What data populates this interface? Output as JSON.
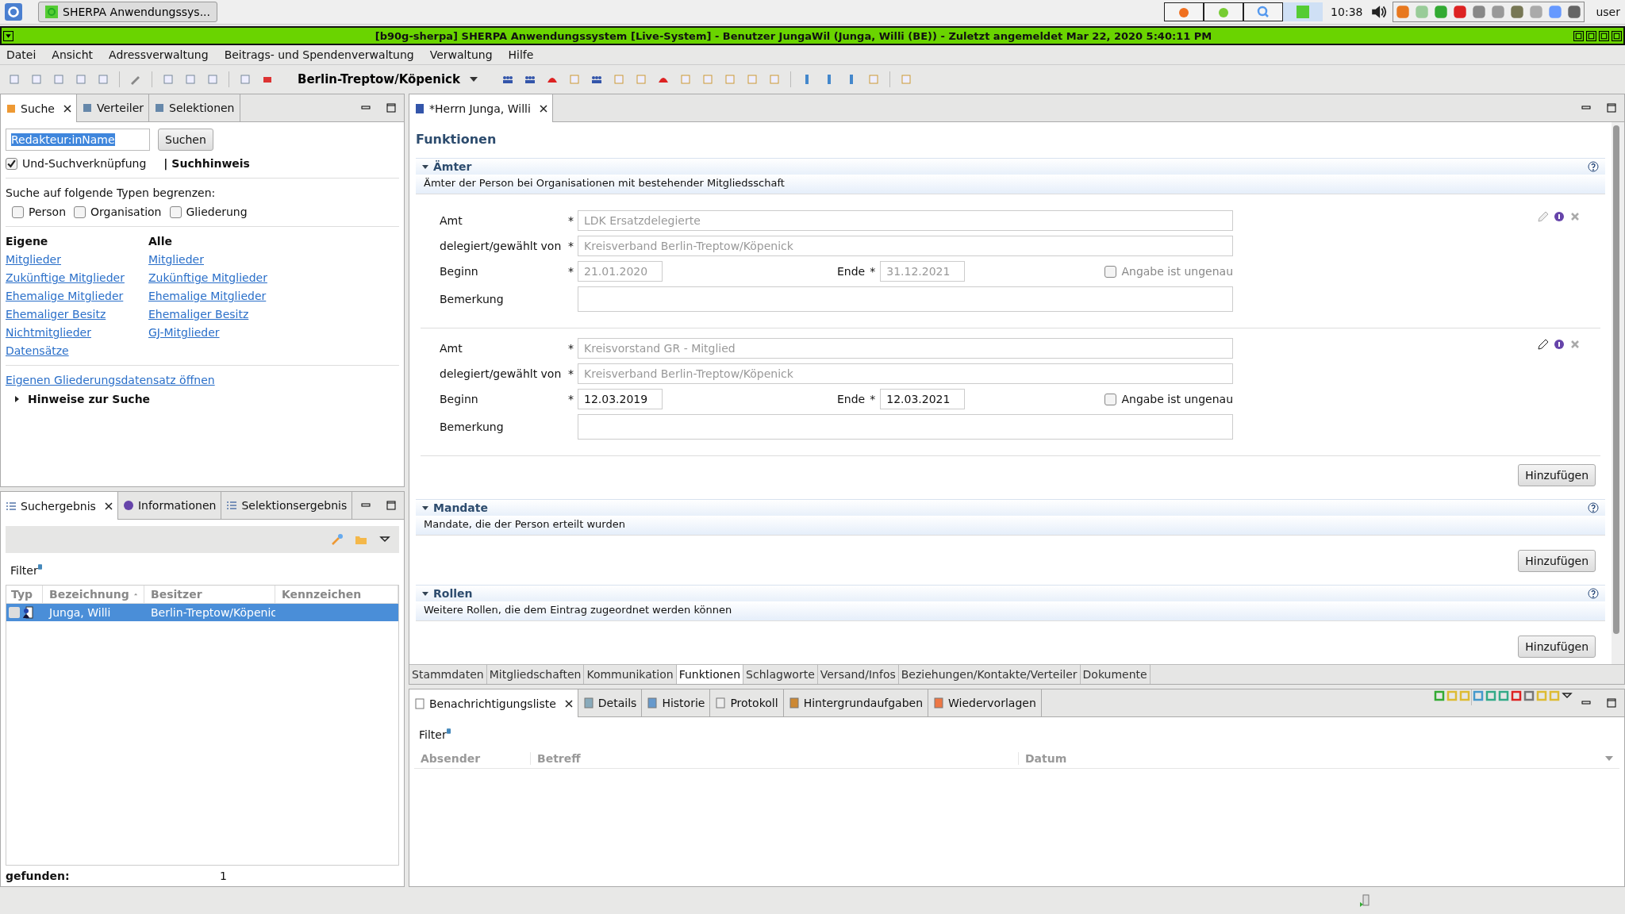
{
  "taskbar": {
    "app_button": "SHERPA Anwendungssys...",
    "clock": "10:38",
    "user": "user"
  },
  "window": {
    "title": "[b90g-sherpa] SHERPA Anwendungssystem [Live-System] - Benutzer JungaWil (Junga, Willi (BE)) - Zuletzt angemeldet Mar 22, 2020 5:40:11 PM"
  },
  "menu": [
    "Datei",
    "Ansicht",
    "Adressverwaltung",
    "Beitrags- und Spendenverwaltung",
    "Verwaltung",
    "Hilfe"
  ],
  "toolbar": {
    "organisation": "Berlin-Treptow/Köpenick"
  },
  "search_panel": {
    "tabs": [
      {
        "label": "Suche",
        "selected": true
      },
      {
        "label": "Verteiler",
        "selected": false
      },
      {
        "label": "Selektionen",
        "selected": false
      }
    ],
    "search_field": {
      "value": "Redakteur:inName"
    },
    "search_button": "Suchen",
    "and_option": {
      "label": "Und-Suchverknüpfung",
      "checked": true
    },
    "hint": "| Suchhinweis",
    "restrict_label": "Suche auf folgende Typen begrenzen:",
    "types": [
      {
        "label": "Person",
        "checked": false
      },
      {
        "label": "Organisation",
        "checked": false
      },
      {
        "label": "Gliederung",
        "checked": false
      }
    ],
    "link_columns": [
      {
        "heading": "Eigene",
        "links": [
          "Mitglieder",
          "Zukünftige Mitglieder",
          "Ehemalige Mitglieder",
          "Ehemaliger Besitz",
          "Nichtmitglieder",
          "Datensätze"
        ]
      },
      {
        "heading": "Alle",
        "links": [
          "Mitglieder",
          "Zukünftige Mitglieder",
          "Ehemalige Mitglieder",
          "Ehemaliger Besitz",
          "GJ-Mitglieder"
        ]
      }
    ],
    "open_link": "Eigenen Gliederungsdatensatz öffnen",
    "hints_section": {
      "label": "Hinweise zur Suche",
      "expanded": false
    }
  },
  "results_panel": {
    "tabs": [
      {
        "label": "Suchergebnis",
        "selected": true
      },
      {
        "label": "Informationen",
        "selected": false
      },
      {
        "label": "Selektionsergebnis",
        "selected": false
      }
    ],
    "filter": "Filter",
    "columns": [
      {
        "label": "Typ",
        "sorted": false
      },
      {
        "label": "Bezeichnung",
        "sorted": true
      },
      {
        "label": "Besitzer",
        "sorted": false
      },
      {
        "label": "Kennzeichen",
        "sorted": false
      }
    ],
    "rows": [
      {
        "selected": true,
        "checked": false,
        "name": "Junga, Willi",
        "owner": "Berlin-Treptow/Köpenic"
      }
    ],
    "found_label": "gefunden:",
    "found_count": "1"
  },
  "editor": {
    "tab": "*Herrn Junga, Willi",
    "heading": "Funktionen",
    "sections": [
      {
        "title": "Ämter",
        "expanded": true,
        "description": "Ämter der Person bei Organisationen mit bestehender Mitgliedsschaft",
        "add_button": "Hinzufügen",
        "entries": [
          {
            "editable": false,
            "amt": {
              "label": "Amt",
              "marker": "*",
              "value": "LDK Ersatzdelegierte",
              "disabled": true
            },
            "delegated": {
              "label": "delegiert/gewählt von",
              "marker": "*",
              "value": "Kreisverband Berlin-Treptow/Köpenick",
              "disabled": true
            },
            "begin": {
              "label": "Beginn",
              "marker": "*",
              "value": "21.01.2020",
              "disabled": true
            },
            "end": {
              "label": "Ende",
              "marker": "*",
              "value": "31.12.2021",
              "disabled": true
            },
            "imprecise": {
              "label": "Angabe ist ungenau",
              "checked": false,
              "disabled": true
            },
            "remark": {
              "label": "Bemerkung"
            }
          },
          {
            "editable": true,
            "amt": {
              "label": "Amt",
              "marker": "*",
              "value": "Kreisvorstand GR - Mitglied",
              "disabled": true
            },
            "delegated": {
              "label": "delegiert/gewählt von",
              "marker": "*",
              "value": "Kreisverband Berlin-Treptow/Köpenick",
              "disabled": true
            },
            "begin": {
              "label": "Beginn",
              "marker": "*",
              "value": "12.03.2019",
              "disabled": false
            },
            "end": {
              "label": "Ende",
              "marker": "*",
              "value": "12.03.2021",
              "disabled": false
            },
            "imprecise": {
              "label": "Angabe ist ungenau",
              "checked": false,
              "disabled": false
            },
            "remark": {
              "label": "Bemerkung"
            }
          }
        ]
      },
      {
        "title": "Mandate",
        "expanded": true,
        "description": "Mandate, die der Person erteilt wurden",
        "add_button": "Hinzufügen"
      },
      {
        "title": "Rollen",
        "expanded": true,
        "description": "Weitere Rollen, die dem Eintrag zugeordnet werden können",
        "add_button": "Hinzufügen"
      }
    ],
    "page_tabs": [
      {
        "label": "Stammdaten",
        "selected": false
      },
      {
        "label": "Mitgliedschaften",
        "selected": false
      },
      {
        "label": "Kommunikation",
        "selected": false
      },
      {
        "label": "Funktionen",
        "selected": true
      },
      {
        "label": "Schlagworte",
        "selected": false
      },
      {
        "label": "Versand/Infos",
        "selected": false
      },
      {
        "label": "Beziehungen/Kontakte/Verteiler",
        "selected": false
      },
      {
        "label": "Dokumente",
        "selected": false
      }
    ]
  },
  "bottom_panel": {
    "tabs": [
      {
        "label": "Benachrichtigungsliste",
        "selected": true
      },
      {
        "label": "Details",
        "selected": false
      },
      {
        "label": "Historie",
        "selected": false
      },
      {
        "label": "Protokoll",
        "selected": false
      },
      {
        "label": "Hintergrundaufgaben",
        "selected": false
      },
      {
        "label": "Wiedervorlagen",
        "selected": false
      }
    ],
    "filter": "Filter",
    "columns": [
      "Absender",
      "Betreff",
      "Datum"
    ]
  }
}
